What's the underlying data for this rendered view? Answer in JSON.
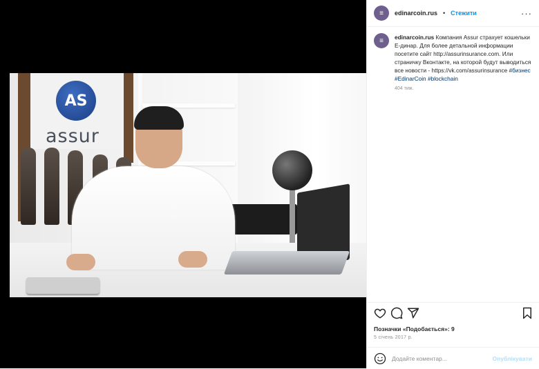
{
  "post": {
    "username": "edinarcoin.rus",
    "separator": "•",
    "follow_label": "Стежити",
    "more_label": "···",
    "avatar_letter": "≡",
    "caption_username": "edinarcoin.rus",
    "caption_text": "Компания Assur страхует кошельки Е-динар. Для более детальной информации посетите сайт http://assurinsurance.com. Или страничку Вконтакте, на которой будут выводиться все новости - https://vk.com/assurinsurance",
    "hashtags": [
      "#бизнес",
      "#EdinarCoin",
      "#blockchain"
    ],
    "caption_time": "404 тиж.",
    "likes_label": "Позначки «Подобається»: 9",
    "date": "5 січень 2017 р.",
    "comment_placeholder": "Додайте коментар...",
    "publish_label": "Опублікувати",
    "photo_logo_text": "assur",
    "photo_logo_mark": "AS"
  },
  "icons": {
    "like": "heart-icon",
    "comment": "comment-icon",
    "share": "share-icon",
    "save": "bookmark-icon",
    "emoji": "emoji-icon"
  },
  "colors": {
    "accent": "#0095f6",
    "text": "#262626",
    "muted": "#8e8e8e",
    "hashtag": "#00376b",
    "avatar": "#6f5f8f",
    "logo_blue": "#1d3f86"
  }
}
